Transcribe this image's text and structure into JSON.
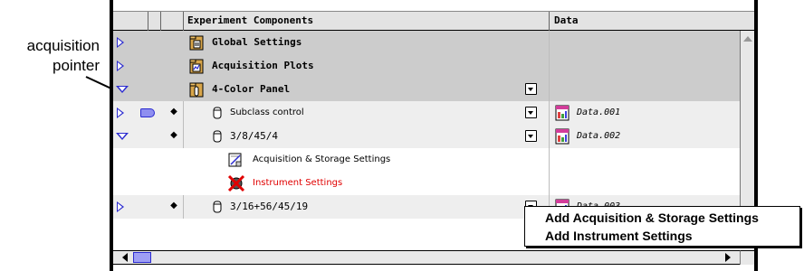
{
  "callout": {
    "line1": "acquisition",
    "line2": "pointer"
  },
  "header": {
    "components_title": "Experiment Components",
    "data_title": "Data"
  },
  "rows": [
    {
      "name": "Global Settings",
      "expanded": false,
      "icon": "folder-settings-icon"
    },
    {
      "name": "Acquisition Plots",
      "expanded": false,
      "icon": "folder-plots-icon"
    },
    {
      "name": "4-Color Panel",
      "expanded": true,
      "icon": "folder-panel-icon",
      "has_menu": true
    },
    {
      "name": "Subclass control",
      "expanded": false,
      "icon": "tube-icon",
      "has_menu": true,
      "data": "Data.001",
      "acquisition_pointer": true
    },
    {
      "name": "3/8/45/4",
      "expanded": true,
      "icon": "tube-icon",
      "has_menu": true,
      "data": "Data.002"
    },
    {
      "name": "Acquisition & Storage Settings",
      "icon": "settings-doc-icon"
    },
    {
      "name": "Instrument Settings",
      "icon": "crossed-out-icon",
      "color": "#e00000"
    },
    {
      "name": "3/16+56/45/19",
      "expanded": false,
      "icon": "tube-icon",
      "has_menu": true,
      "data": "Data.003"
    }
  ],
  "popup_menu": {
    "items": [
      "Add Acquisition & Storage Settings",
      "Add Instrument Settings"
    ]
  },
  "colors": {
    "selection_blue": "#2b2bd0",
    "warning_red": "#e00000",
    "row_gray": "#cccccc"
  }
}
